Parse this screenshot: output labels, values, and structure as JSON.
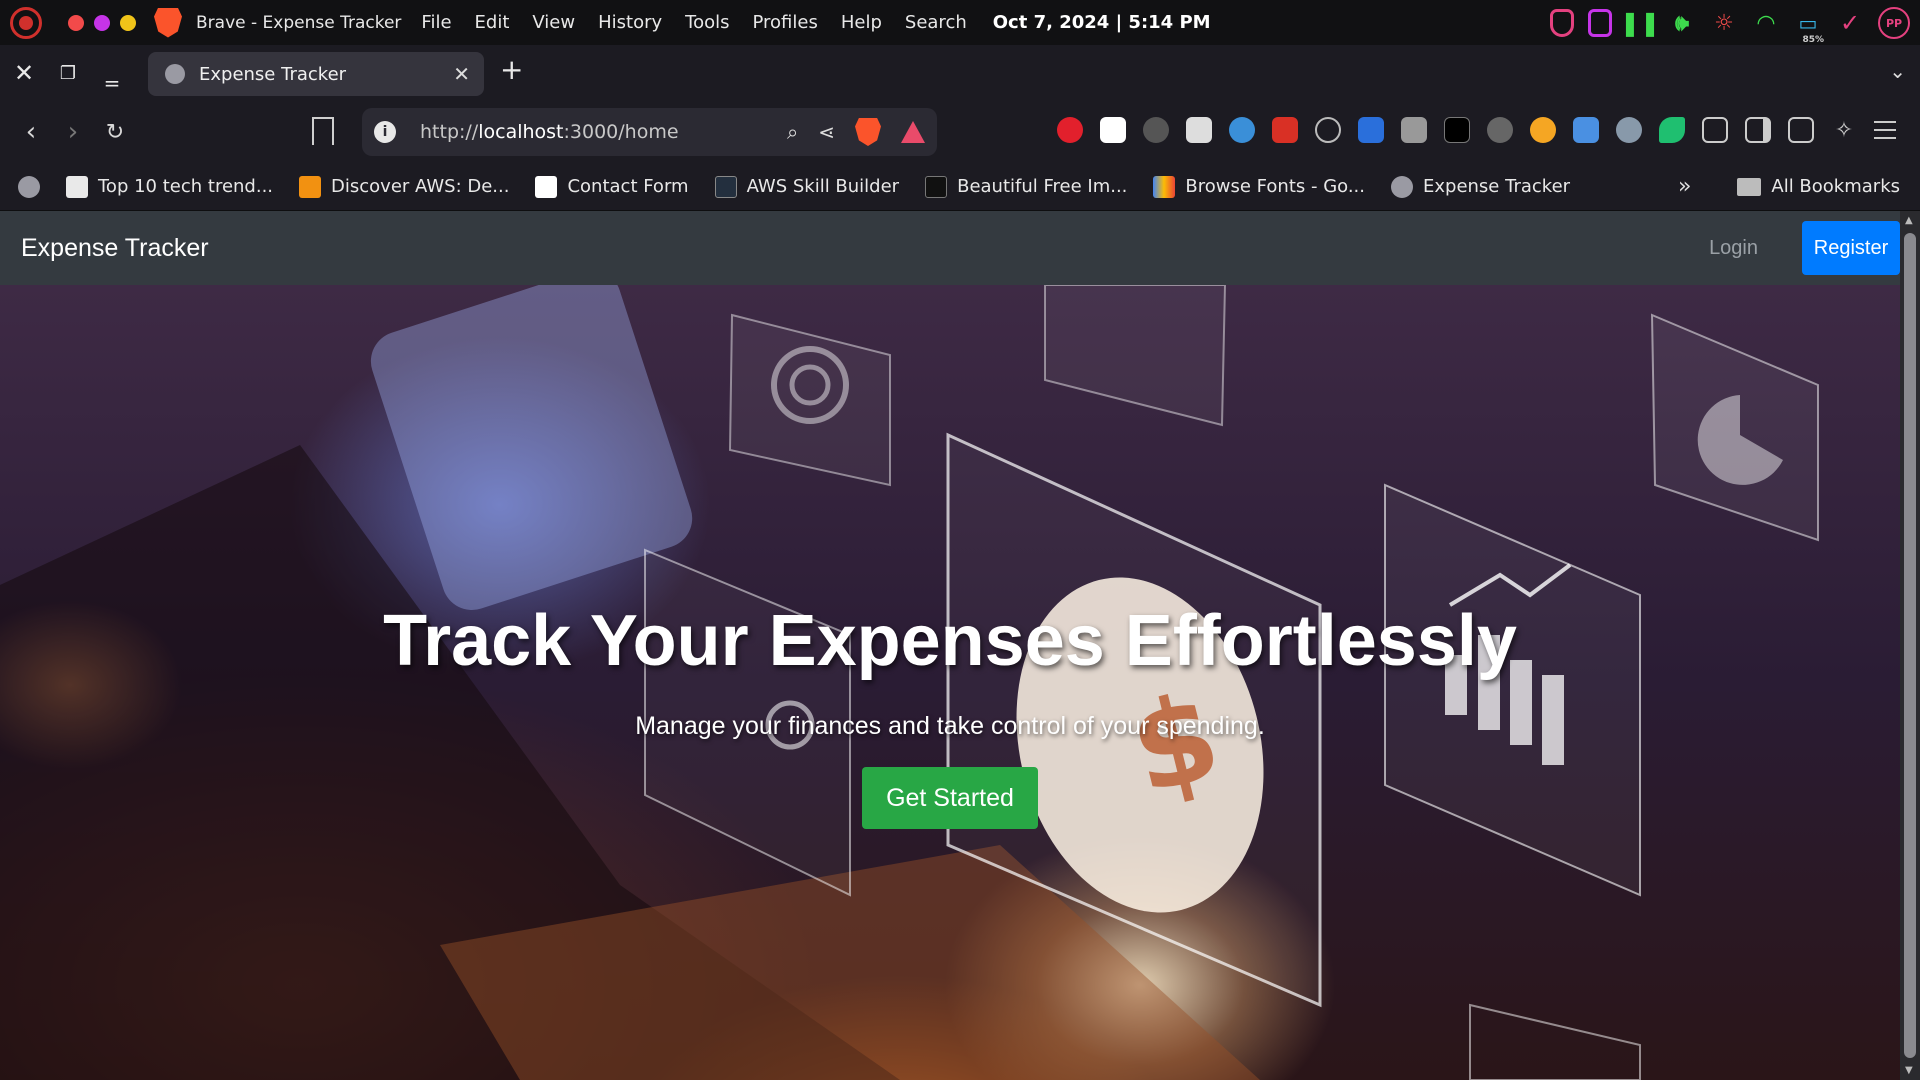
{
  "os": {
    "window_title": "Brave - Expense Tracker",
    "menu": [
      "File",
      "Edit",
      "View",
      "History",
      "Tools",
      "Profiles",
      "Help",
      "Search"
    ],
    "clock": "Oct 7, 2024 | 5:14 PM",
    "battery": "85%",
    "avatar": "PP",
    "traffic_colors": [
      "#f24a4a",
      "#c634e8",
      "#f0c419"
    ]
  },
  "tabs": [
    {
      "title": "Expense Tracker",
      "icon": "globe-icon"
    }
  ],
  "toolbar": {
    "url_scheme": "http://",
    "url_host": "localhost",
    "url_rest": ":3000/home"
  },
  "bookmarks": [
    {
      "label": "Top 10 tech trend...",
      "icon": "page-icon",
      "color": "#e9e9e9"
    },
    {
      "label": "Discover AWS: De...",
      "icon": "aws-cube-icon",
      "color": "#f29111"
    },
    {
      "label": "Contact Form",
      "icon": "form-icon",
      "color": "#ffffff"
    },
    {
      "label": "AWS Skill Builder",
      "icon": "aws-icon",
      "color": "#232f3e"
    },
    {
      "label": "Beautiful Free Im...",
      "icon": "camera-icon",
      "color": "#111111"
    },
    {
      "label": "Browse Fonts - Go...",
      "icon": "google-fonts-icon",
      "color": "#4285f4"
    },
    {
      "label": "Expense Tracker",
      "icon": "globe-icon",
      "color": "#9a9aa3"
    }
  ],
  "bookmarks_all": "All Bookmarks",
  "site": {
    "brand": "Expense Tracker",
    "login": "Login",
    "register": "Register",
    "hero_title": "Track Your Expenses Effortlessly",
    "hero_subtitle": "Manage your finances and take control of your spending.",
    "cta": "Get Started",
    "colors": {
      "navbar": "#343a40",
      "primary": "#007bff",
      "success": "#28a745"
    }
  }
}
